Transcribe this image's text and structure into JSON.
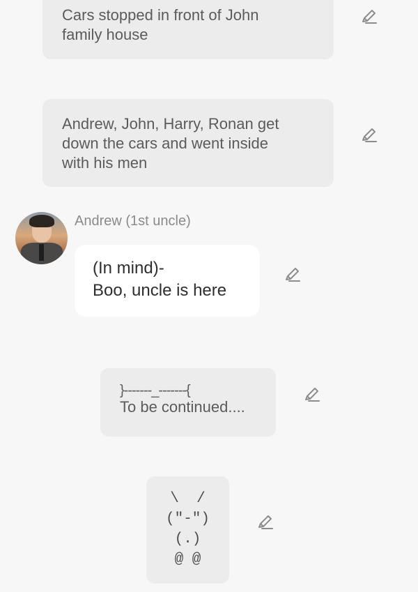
{
  "messages": {
    "narration_1": {
      "text_line1": "Cars stopped in front of John",
      "text_line2": "family house"
    },
    "narration_2": {
      "text_line1": "Andrew, John, Harry, Ronan get",
      "text_line2": "down the cars and went inside",
      "text_line3": "with his men"
    },
    "character_message": {
      "speaker": "Andrew (1st uncle)",
      "line1": "(In mind)-",
      "line2": "Boo, uncle is here"
    },
    "narration_3": {
      "decoration": "}-------_-------{",
      "text": "To be continued...."
    },
    "narration_4": {
      "art_line1": "\\  /",
      "art_line2": "(\"-\")",
      "art_line3": "(.)",
      "art_line4": "@ @"
    }
  },
  "icons": {
    "edit": "pencil-edit-icon",
    "avatar": "character-avatar"
  },
  "colors": {
    "background": "#f7f7f7",
    "narration_bubble": "#ececec",
    "dialogue_bubble": "#ffffff",
    "icon": "#8c8c8c"
  }
}
